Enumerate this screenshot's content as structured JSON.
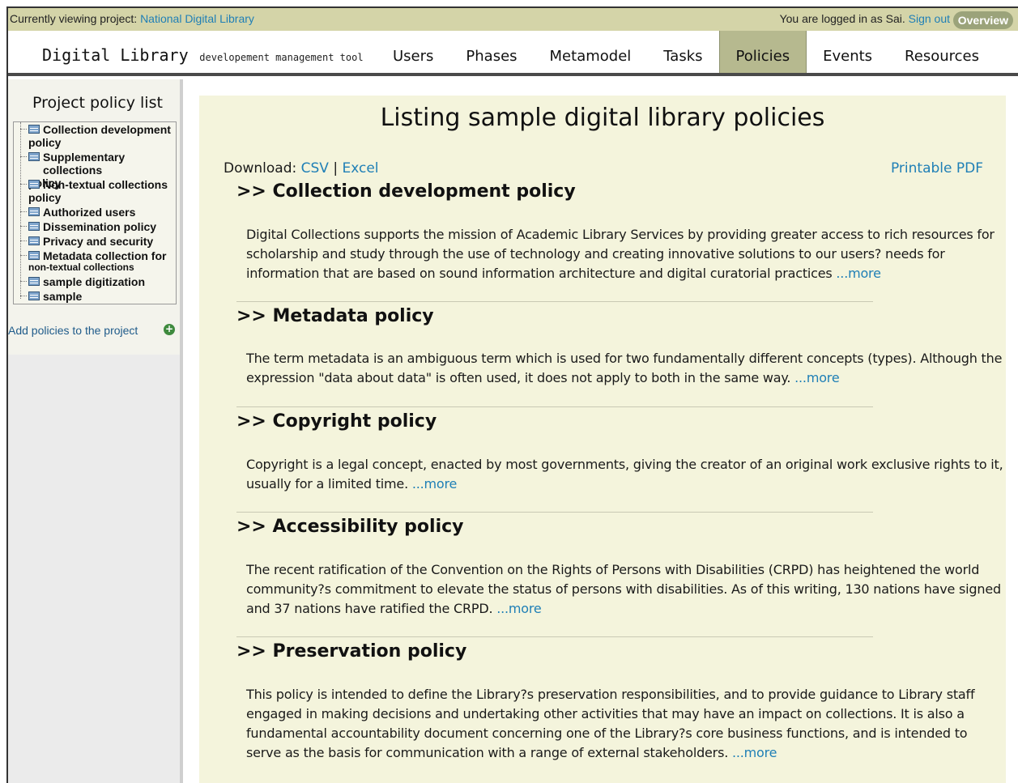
{
  "topbar": {
    "viewing_label": "Currently viewing project:",
    "project_name": "National Digital Library",
    "logged_in_text": "You are logged in as Sai.",
    "sign_out": "Sign out",
    "overview": "Overview"
  },
  "header": {
    "brand_big": "Digital Library",
    "brand_small": "developement management tool",
    "tabs": [
      {
        "label": "Users"
      },
      {
        "label": "Phases"
      },
      {
        "label": "Metamodel"
      },
      {
        "label": "Tasks"
      },
      {
        "label": "Policies",
        "active": true
      },
      {
        "label": "Events"
      },
      {
        "label": "Resources"
      }
    ]
  },
  "sidebar": {
    "title": "Project policy list",
    "items": [
      {
        "label": "Collection development",
        "label2": "policy"
      },
      {
        "label": "Supplementary collections",
        "label2": "policy"
      },
      {
        "label": "Non-textual collections",
        "label2": "policy"
      },
      {
        "label": "Authorized users"
      },
      {
        "label": "Dissemination policy"
      },
      {
        "label": "Privacy and security"
      },
      {
        "label": "Metadata collection for",
        "label2": "non-textual collections"
      },
      {
        "label": "sample digitization"
      },
      {
        "label": "sample"
      }
    ],
    "add_link": "Add policies to the project",
    "add_icon": "plus-circle-icon"
  },
  "main": {
    "title": "Listing sample digital library policies",
    "download_label": "Download:",
    "csv": "CSV",
    "divider": "|",
    "excel": "Excel",
    "printable_pdf": "Printable PDF",
    "more_label": "...more",
    "policies": [
      {
        "title": ">> Collection development policy",
        "body": "Digital Collections supports the mission of Academic Library Services by providing greater access to rich resources for scholarship and study through the use of technology and creating innovative solutions to our users? needs for information that are based on sound information architecture and digital curatorial practices"
      },
      {
        "title": ">> Metadata policy",
        "body": "The term metadata is an ambiguous term which is used for two fundamentally different concepts (types). Although the expression \"data about data\" is often used, it does not apply to both in the same way."
      },
      {
        "title": ">> Copyright policy",
        "body": "Copyright is a legal concept, enacted by most governments, giving the creator of an original work exclusive rights to it, usually for a limited time."
      },
      {
        "title": ">> Accessibility policy",
        "body": "The recent ratification of the Convention on the Rights of Persons with Disabilities (CRPD) has heightened the world community?s commitment to elevate the status of persons with disabilities. As of this writing, 130 nations have signed and 37 nations have ratified the CRPD."
      },
      {
        "title": ">> Preservation policy",
        "body": "This policy is intended to define the Library?s preservation responsibilities, and to provide guidance to Library staff engaged in making decisions and undertaking other activities that may have an impact on collections. It is also a fundamental accountability document concerning one of the Library?s core business functions, and is intended to serve as the basis for communication with a range of external stakeholders."
      }
    ]
  }
}
